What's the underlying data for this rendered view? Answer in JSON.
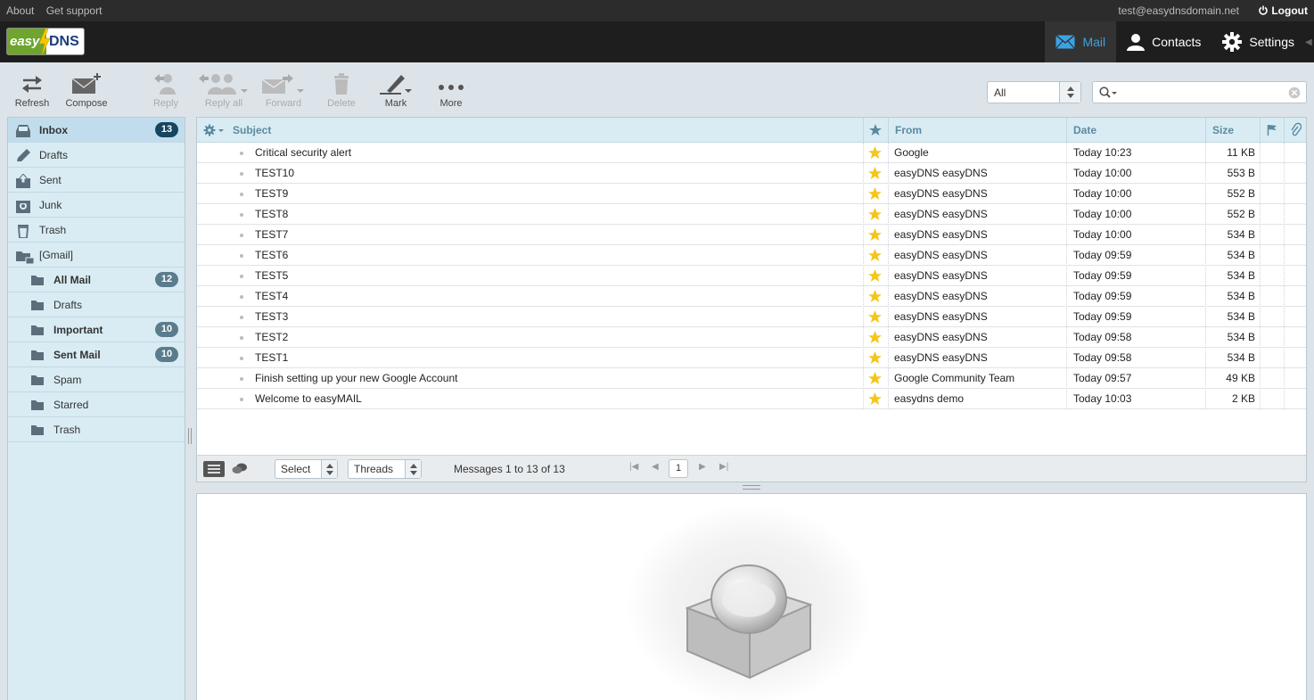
{
  "topline": {
    "links": [
      "About",
      "Get support"
    ],
    "user": "test@easydnsdomain.net",
    "logout": "Logout"
  },
  "logo": {
    "part1": "easy",
    "part2": "DNS"
  },
  "topnav": [
    {
      "label": "Mail",
      "icon": "envelope-icon",
      "active": true
    },
    {
      "label": "Contacts",
      "icon": "person-icon",
      "active": false
    },
    {
      "label": "Settings",
      "icon": "gear-icon",
      "active": false
    }
  ],
  "toolbar": {
    "refresh": "Refresh",
    "compose": "Compose",
    "reply": "Reply",
    "reply_all": "Reply all",
    "forward": "Forward",
    "delete": "Delete",
    "mark": "Mark",
    "more": "More",
    "filter_value": "All",
    "search_placeholder": ""
  },
  "folders": [
    {
      "name": "Inbox",
      "icon": "inbox-icon",
      "count": "13",
      "active": true
    },
    {
      "name": "Drafts",
      "icon": "pencil-icon",
      "count": ""
    },
    {
      "name": "Sent",
      "icon": "sent-icon",
      "count": ""
    },
    {
      "name": "Junk",
      "icon": "junk-icon",
      "count": ""
    },
    {
      "name": "Trash",
      "icon": "trash-icon",
      "count": ""
    },
    {
      "name": "[Gmail]",
      "icon": "folder-group-icon",
      "count": ""
    },
    {
      "name": "All Mail",
      "icon": "folder-icon",
      "count": "12",
      "sub": true,
      "bold": true
    },
    {
      "name": "Drafts",
      "icon": "folder-icon",
      "count": "",
      "sub": true
    },
    {
      "name": "Important",
      "icon": "folder-icon",
      "count": "10",
      "sub": true,
      "bold": true
    },
    {
      "name": "Sent Mail",
      "icon": "folder-icon",
      "count": "10",
      "sub": true,
      "bold": true
    },
    {
      "name": "Spam",
      "icon": "folder-icon",
      "count": "",
      "sub": true
    },
    {
      "name": "Starred",
      "icon": "folder-icon",
      "count": "",
      "sub": true
    },
    {
      "name": "Trash",
      "icon": "folder-icon",
      "count": "",
      "sub": true
    }
  ],
  "columns": {
    "subject": "Subject",
    "from": "From",
    "date": "Date",
    "size": "Size"
  },
  "messages": [
    {
      "subject": "Critical security alert",
      "from": "Google",
      "date": "Today 10:23",
      "size": "11 KB"
    },
    {
      "subject": "TEST10",
      "from": "easyDNS easyDNS",
      "date": "Today 10:00",
      "size": "553 B"
    },
    {
      "subject": "TEST9",
      "from": "easyDNS easyDNS",
      "date": "Today 10:00",
      "size": "552 B"
    },
    {
      "subject": "TEST8",
      "from": "easyDNS easyDNS",
      "date": "Today 10:00",
      "size": "552 B"
    },
    {
      "subject": "TEST7",
      "from": "easyDNS easyDNS",
      "date": "Today 10:00",
      "size": "534 B"
    },
    {
      "subject": "TEST6",
      "from": "easyDNS easyDNS",
      "date": "Today 09:59",
      "size": "534 B"
    },
    {
      "subject": "TEST5",
      "from": "easyDNS easyDNS",
      "date": "Today 09:59",
      "size": "534 B"
    },
    {
      "subject": "TEST4",
      "from": "easyDNS easyDNS",
      "date": "Today 09:59",
      "size": "534 B"
    },
    {
      "subject": "TEST3",
      "from": "easyDNS easyDNS",
      "date": "Today 09:59",
      "size": "534 B"
    },
    {
      "subject": "TEST2",
      "from": "easyDNS easyDNS",
      "date": "Today 09:58",
      "size": "534 B"
    },
    {
      "subject": "TEST1",
      "from": "easyDNS easyDNS",
      "date": "Today 09:58",
      "size": "534 B"
    },
    {
      "subject": "Finish setting up your new Google Account",
      "from": "Google Community Team",
      "date": "Today 09:57",
      "size": "49 KB"
    },
    {
      "subject": "Welcome to easyMAIL",
      "from": "easydns demo",
      "date": "Today 10:03",
      "size": "2 KB"
    }
  ],
  "footer": {
    "select": "Select",
    "threads": "Threads",
    "count": "Messages 1 to 13 of 13",
    "page": "1"
  },
  "colors": {
    "accent": "#3aa3e3",
    "star": "#f5c518",
    "badge": "#5a7c8c",
    "badge_active": "#15465e"
  }
}
